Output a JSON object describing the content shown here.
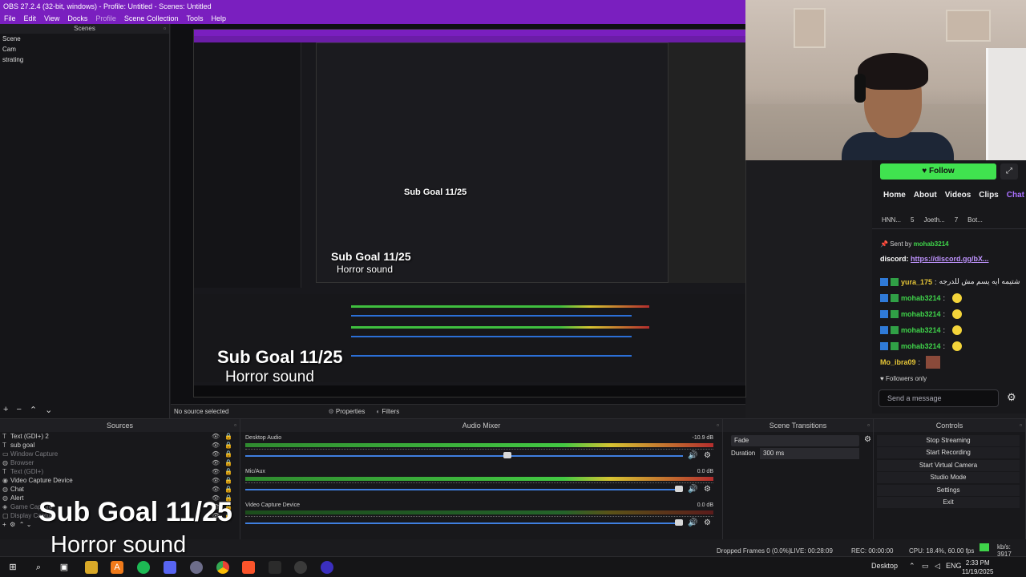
{
  "window": {
    "title": "OBS 27.2.4 (32-bit, windows) - Profile: Untitled - Scenes: Untitled"
  },
  "menu": [
    "File",
    "Edit",
    "View",
    "Docks",
    "Profile",
    "Scene Collection",
    "Tools",
    "Help"
  ],
  "scenes": {
    "header": "Scenes",
    "items": [
      "Scene",
      "Cam",
      "strating"
    ]
  },
  "source_bar": {
    "selected": "No source selected",
    "properties": "Properties",
    "filters": "Filters"
  },
  "sources": {
    "header": "Sources",
    "items": [
      {
        "icon": "text-icon",
        "label": "Text (GDI+) 2",
        "dim": false
      },
      {
        "icon": "text-icon",
        "label": "sub goal",
        "dim": false
      },
      {
        "icon": "window-icon",
        "label": "Window Capture",
        "dim": true
      },
      {
        "icon": "browser-icon",
        "label": "Browser",
        "dim": true
      },
      {
        "icon": "text-icon",
        "label": "Text (GDI+)",
        "dim": true
      },
      {
        "icon": "camera-icon",
        "label": "Video Capture Device",
        "dim": false
      },
      {
        "icon": "browser-icon",
        "label": "Chat",
        "dim": false
      },
      {
        "icon": "browser-icon",
        "label": "Alert",
        "dim": false
      },
      {
        "icon": "game-icon",
        "label": "Game Capture",
        "dim": true
      },
      {
        "icon": "monitor-icon",
        "label": "Display Capture",
        "dim": true
      }
    ]
  },
  "mixer": {
    "header": "Audio Mixer",
    "channels": [
      {
        "name": "Desktop Audio",
        "db": "-10.9 dB",
        "level": 0.85,
        "volume": 0.6
      },
      {
        "name": "Mic/Aux",
        "db": "0.0 dB",
        "level": 0.72,
        "volume": 1.0
      },
      {
        "name": "Video Capture Device",
        "db": "0.0 dB",
        "level": 0.0,
        "volume": 1.0
      }
    ]
  },
  "transitions": {
    "header": "Scene Transitions",
    "selected": "Fade",
    "duration_label": "Duration",
    "duration_value": "300 ms"
  },
  "controls": {
    "header": "Controls",
    "buttons": [
      "Stop Streaming",
      "Start Recording",
      "Start Virtual Camera",
      "Studio Mode",
      "Settings",
      "Exit"
    ]
  },
  "status": {
    "dropped": "Dropped Frames 0 (0.0%)",
    "live": "LIVE: 00:28:09",
    "rec": "REC: 00:00:00",
    "cpu": "CPU: 18.4%, 60.00 fps",
    "kbps": "kb/s: 3917"
  },
  "overlay": {
    "sub_goal": "Sub Goal 11/25",
    "sound": "Horror sound"
  },
  "twitch": {
    "follow": "Follow",
    "tabs": [
      "Home",
      "About",
      "Videos",
      "Clips",
      "Chat"
    ],
    "pinned": [
      "HNN...",
      "5",
      "Joeth...",
      "7",
      "Bot..."
    ],
    "sent_by": "Sent by",
    "sent_by_user": "mohab3214",
    "discord_label": "discord:",
    "discord_link": "https://discord.gg/bX...",
    "messages": [
      {
        "user": "yura_175",
        "text": "شتيمه ايه يسم مش للدرجه",
        "color": "yellow"
      },
      {
        "user": "mohab3214",
        "text": "",
        "color": "green"
      },
      {
        "user": "mohab3214",
        "text": "",
        "color": "green"
      },
      {
        "user": "mohab3214",
        "text": "",
        "color": "green"
      },
      {
        "user": "mohab3214",
        "text": "",
        "color": "green"
      },
      {
        "user": "Mo_ibra09",
        "text": "",
        "color": "yellow"
      }
    ],
    "followers_only": "Followers only",
    "input_placeholder": "Send a message"
  },
  "taskbar": {
    "desktop_label": "Desktop",
    "lang": "ENG",
    "time": "2:33 PM",
    "date": "11/19/2025"
  },
  "nested": {
    "goal1": "Sub Goal 11/25",
    "goal2": "Sub Goal 11/25",
    "goal3": "Sub Goal 11/25",
    "sound1": "Horror sound",
    "sound2": "Horror sound"
  }
}
